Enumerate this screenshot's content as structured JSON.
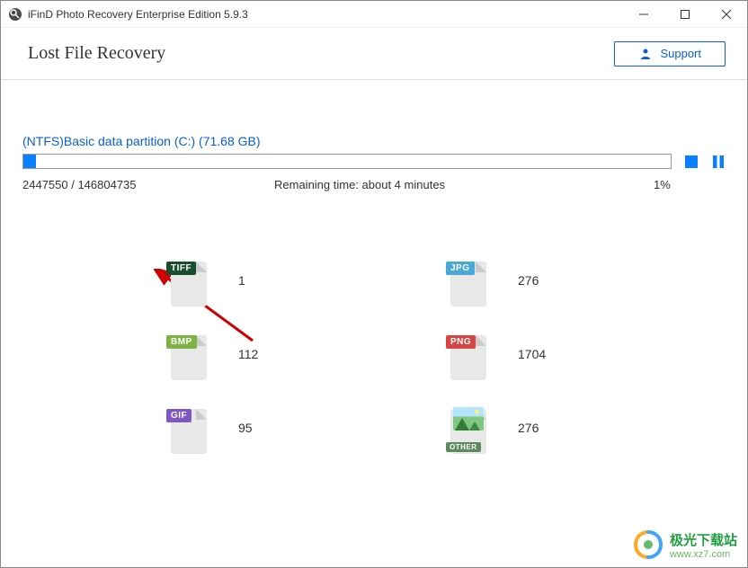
{
  "titlebar": {
    "title": "iFinD Photo Recovery Enterprise Edition 5.9.3"
  },
  "header": {
    "title": "Lost File Recovery",
    "support_label": "Support"
  },
  "scan": {
    "partition_label": "(NTFS)Basic data partition (C:) (71.68 GB)",
    "progress_percent": 2,
    "processed": "2447550 / 146804735",
    "remaining_label": "Remaining time: about  4  minutes",
    "percent_text": "1%"
  },
  "files": {
    "items": [
      {
        "type": "TIFF",
        "count": "1",
        "badge_class": "tiff"
      },
      {
        "type": "JPG",
        "count": "276",
        "badge_class": "jpg"
      },
      {
        "type": "BMP",
        "count": "112",
        "badge_class": "bmp"
      },
      {
        "type": "PNG",
        "count": "1704",
        "badge_class": "png"
      },
      {
        "type": "GIF",
        "count": "95",
        "badge_class": "gif"
      },
      {
        "type": "OTHER",
        "count": "276",
        "badge_class": "other"
      }
    ]
  },
  "watermark": {
    "line1": "极光下载站",
    "line2": "www.xz7.com"
  }
}
